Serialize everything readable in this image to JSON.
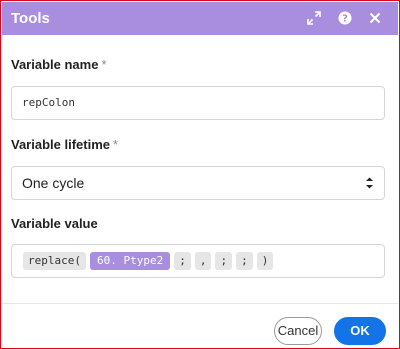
{
  "dialog": {
    "title": "Tools"
  },
  "variable_name": {
    "label": "Variable name",
    "required_mark": "*",
    "value": "repColon"
  },
  "variable_lifetime": {
    "label": "Variable lifetime",
    "required_mark": "*",
    "selected": "One cycle"
  },
  "variable_value": {
    "label": "Variable value",
    "tokens": [
      {
        "text": "replace(",
        "kind": "function"
      },
      {
        "text": "60. Ptype2",
        "kind": "variable"
      },
      {
        "text": ";",
        "kind": "text"
      },
      {
        "text": ",",
        "kind": "text"
      },
      {
        "text": ";",
        "kind": "text"
      },
      {
        "text": ";",
        "kind": "text"
      },
      {
        "text": ")",
        "kind": "function"
      }
    ]
  },
  "footer": {
    "cancel_label": "Cancel",
    "ok_label": "OK"
  },
  "icons": {
    "expand": "expand-icon",
    "help": "help-icon",
    "close": "close-icon"
  },
  "colors": {
    "header": "#a98ee0",
    "accent": "#1473e6",
    "frame_border": "#e0001b"
  }
}
